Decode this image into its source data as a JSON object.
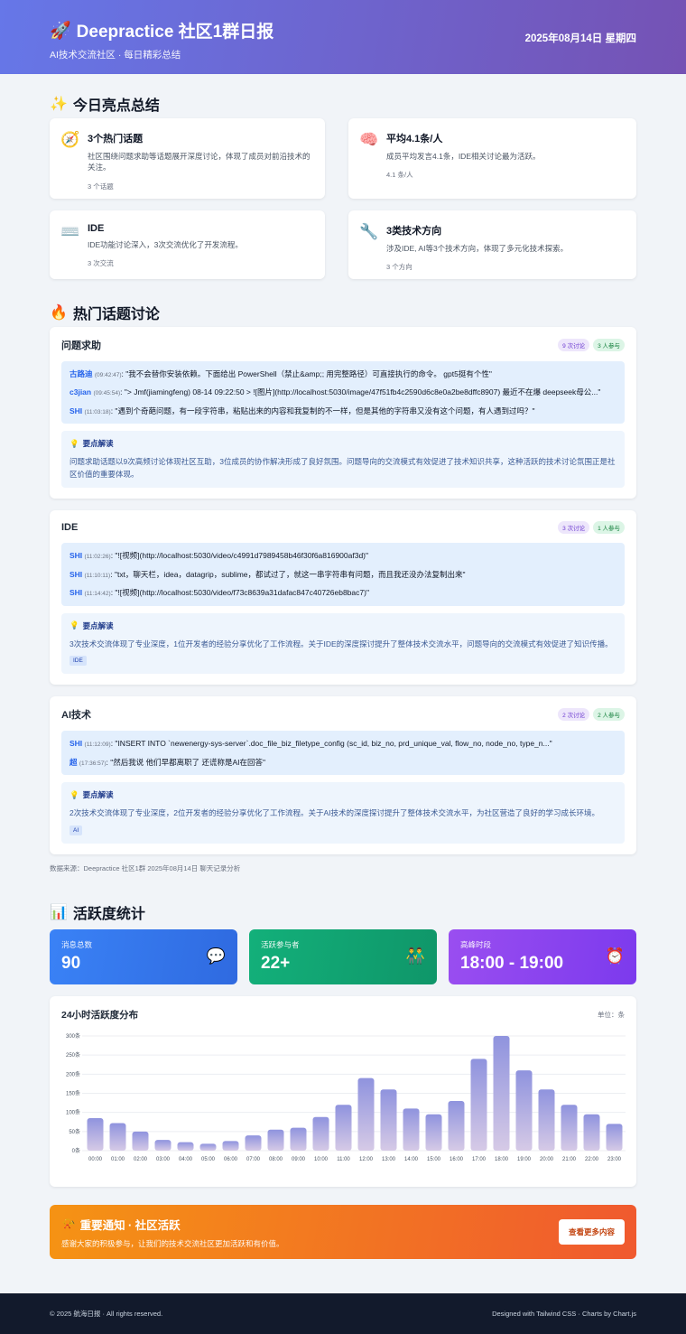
{
  "header": {
    "icon": "🚀",
    "title": "Deepractice 社区1群日报",
    "subtitle": "AI技术交流社区 · 每日精彩总结",
    "date": "2025年08月14日 星期四"
  },
  "highlights": {
    "icon": "✨",
    "title": "今日亮点总结",
    "cards": [
      {
        "icon": "🧭",
        "title": "3个热门话题",
        "desc": "社区围绕问题求助等话题展开深度讨论，体现了成员对前沿技术的关注。",
        "meta": "3 个话题"
      },
      {
        "icon": "🧠",
        "title": "平均4.1条/人",
        "desc": "成员平均发言4.1条，IDE相关讨论最为活跃。",
        "meta": "4.1 条/人"
      },
      {
        "icon": "⌨️",
        "title": "IDE",
        "desc": "IDE功能讨论深入，3次交流优化了开发流程。",
        "meta": "3 次交流"
      },
      {
        "icon": "🔧",
        "title": "3类技术方向",
        "desc": "涉及IDE, AI等3个技术方向，体现了多元化技术探索。",
        "meta": "3 个方向"
      }
    ]
  },
  "topics_section": {
    "icon": "🔥",
    "title": "热门话题讨论",
    "insight_icon": "💡",
    "insight_label": "要点解读",
    "topics": [
      {
        "name": "问题求助",
        "discussions": "9 次讨论",
        "participants": "3 人参与",
        "messages": [
          {
            "user": "古路迪",
            "time": "(09:42:47)",
            "text": ": \"我不会替你安装依赖。下面给出 PowerShell（禁止&amp;; 用完整路径）可直接执行的命令。 gpt5挺有个性\""
          },
          {
            "user": "c3jian",
            "time": "(09:45:54)",
            "text": ": \"> Jmf(jiamingfeng) 08-14 09:22:50 > ![图片](http://localhost:5030/image/47f51fb4c2590d6c8e0a2be8dffc8907) 最近不在爆 deepseek母公...\""
          },
          {
            "user": "SHI",
            "time": "(11:03:18)",
            "text": ": \"遇到个奇葩问题，有一段字符串，粘贴出来的内容和我复制的不一样，但是其他的字符串又没有这个问题，有人遇到过吗？\""
          }
        ],
        "insight": "问题求助话题以9次高频讨论体现社区互助，3位成员的协作解决形成了良好氛围。问题导向的交流模式有效促进了技术知识共享，这种活跃的技术讨论氛围正是社区价值的重要体现。",
        "tag": ""
      },
      {
        "name": "IDE",
        "discussions": "3 次讨论",
        "participants": "1 人参与",
        "messages": [
          {
            "user": "SHI",
            "time": "(11:02:26)",
            "text": ": \"![视频](http://localhost:5030/video/c4991d7989458b46f30f6a816900af3d)\""
          },
          {
            "user": "SHI",
            "time": "(11:10:11)",
            "text": ": \"txt，聊天栏，idea，datagrip，sublime，都试过了，就这一串字符串有问题，而且我还没办法复制出来\""
          },
          {
            "user": "SHI",
            "time": "(11:14:42)",
            "text": ": \"![视频](http://localhost:5030/video/f73c8639a31dafac847c40726eb8bac7)\""
          }
        ],
        "insight": "3次技术交流体现了专业深度，1位开发者的经验分享优化了工作流程。关于IDE的深度探讨提升了整体技术交流水平，问题导向的交流模式有效促进了知识传播。",
        "tag": "IDE"
      },
      {
        "name": "AI技术",
        "discussions": "2 次讨论",
        "participants": "2 人参与",
        "messages": [
          {
            "user": "SHI",
            "time": "(11:12:09)",
            "text": ": \"INSERT INTO `newenergy-sys-server`.doc_file_biz_filetype_config (sc_id, biz_no, prd_unique_val, flow_no, node_no, type_n...\""
          },
          {
            "user": "超",
            "time": "(17:36:57)",
            "text": ": \"然后我说 他们早都离职了 还谎称是AI在回答\""
          }
        ],
        "insight": "2次技术交流体现了专业深度，2位开发者的经验分享优化了工作流程。关于AI技术的深度探讨提升了整体技术交流水平，为社区营造了良好的学习成长环境。",
        "tag": "AI"
      }
    ],
    "source": "数据来源：Deepractice 社区1群 2025年08月14日 聊天记录分析"
  },
  "activity": {
    "icon": "📊",
    "title": "活跃度统计",
    "stats": [
      {
        "label": "消息总数",
        "value": "90",
        "icon": "💬"
      },
      {
        "label": "活跃参与者",
        "value": "22+",
        "icon": "👬"
      },
      {
        "label": "高峰时段",
        "value": "18:00 - 19:00",
        "icon": "⏰"
      }
    ]
  },
  "chart_data": {
    "type": "bar",
    "title": "24小时活跃度分布",
    "unit": "单位：条",
    "categories": [
      "00:00",
      "01:00",
      "02:00",
      "03:00",
      "04:00",
      "05:00",
      "06:00",
      "07:00",
      "08:00",
      "09:00",
      "10:00",
      "11:00",
      "12:00",
      "13:00",
      "14:00",
      "15:00",
      "16:00",
      "17:00",
      "18:00",
      "19:00",
      "20:00",
      "21:00",
      "22:00",
      "23:00"
    ],
    "values": [
      85,
      72,
      50,
      28,
      22,
      18,
      25,
      40,
      55,
      60,
      88,
      120,
      190,
      160,
      110,
      95,
      130,
      240,
      300,
      210,
      160,
      120,
      95,
      70
    ],
    "y_ticks": [
      "0条",
      "50条",
      "100条",
      "150条",
      "200条",
      "250条",
      "300条"
    ],
    "ylim": [
      0,
      300
    ],
    "colors": {
      "bar_top": "#8f93de",
      "bar_bottom": "#d6cae6"
    }
  },
  "notice": {
    "icon": "📯",
    "title": "重要通知 · 社区活跃",
    "text": "感谢大家的积极参与，让我们的技术交流社区更加活跃和有价值。",
    "button": "查看更多内容"
  },
  "footer": {
    "left": "© 2025 航海日报 · All rights reserved.",
    "right": "Designed with Tailwind CSS · Charts by Chart.js"
  }
}
